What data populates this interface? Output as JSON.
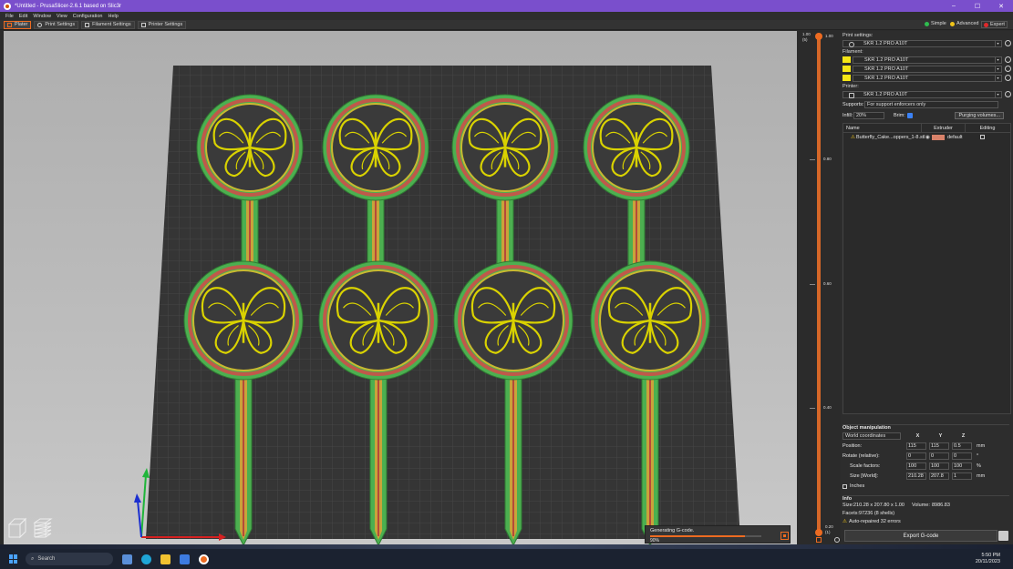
{
  "window": {
    "title": "*Untitled - PrusaSlicer-2.6.1 based on Slic3r",
    "controls": [
      "–",
      "☐",
      "✕"
    ]
  },
  "menu": [
    "File",
    "Edit",
    "Window",
    "View",
    "Configuration",
    "Help"
  ],
  "tabs": [
    {
      "label": "Plater",
      "icon": "plater-icon",
      "active": true
    },
    {
      "label": "Print Settings",
      "icon": "gear-icon",
      "active": false
    },
    {
      "label": "Filament Settings",
      "icon": "spool-icon",
      "active": false
    },
    {
      "label": "Printer Settings",
      "icon": "printer-icon",
      "active": false
    }
  ],
  "modes": [
    {
      "label": "Simple",
      "color": "#2fbd4f"
    },
    {
      "label": "Advanced",
      "color": "#f0c419"
    },
    {
      "label": "Expert",
      "color": "#e0292b"
    }
  ],
  "layer_slider": {
    "top_value": "1.00",
    "top_index": "(5)",
    "bottom_value": "0.20",
    "bottom_index": "(1)",
    "ticks": [
      "0.80",
      "0.60",
      "0.40"
    ],
    "accent": "#ed6b21"
  },
  "sidebar": {
    "print_settings_label": "Print settings:",
    "print_preset": "SKR 1.2 PRO A10T",
    "filament_label": "Filament:",
    "filaments": [
      {
        "name": "SKR 1.2 PRO A10T",
        "color": "#f5e616"
      },
      {
        "name": "SKR 1.2 PRO A10T",
        "color": "#f5e616"
      },
      {
        "name": "SKR 1.2 PRO A10T",
        "color": "#f5e616"
      }
    ],
    "printer_label": "Printer:",
    "printer_preset": "SKR 1.2 PRO A10T",
    "supports_label": "Supports:",
    "supports_value": "For support enforcers only",
    "infill_label": "Infill:",
    "infill_value": "20%",
    "brim_label": "Brim:",
    "purging_label": "Purging volumes...",
    "table_headers": [
      "Name",
      "Extruder",
      "Editing"
    ],
    "object_name": "Butterfly_Cake...oppers_1-8.stl",
    "extruder": "default",
    "extruder_color": "#d9826a"
  },
  "object_manipulation": {
    "title": "Object manipulation",
    "coords": "World coordinates",
    "axes": [
      "X",
      "Y",
      "Z"
    ],
    "position_label": "Position:",
    "position": [
      "115",
      "115",
      "0.5"
    ],
    "position_unit": "mm",
    "rotate_label": "Rotate (relative):",
    "rotate": [
      "0",
      "0",
      "0"
    ],
    "rotate_unit": "°",
    "scale_label": "Scale factors:",
    "scale": [
      "100",
      "100",
      "100"
    ],
    "scale_unit": "%",
    "size_label": "Size [World]:",
    "size": [
      "210.28",
      "207.8",
      "1"
    ],
    "size_unit": "mm",
    "inches_label": "Inches"
  },
  "info": {
    "title": "Info",
    "size_label": "Size:",
    "size_value": "210.28 x 207.80 x 1.00",
    "volume_label": "Volume:",
    "volume_value": "8986.83",
    "facets_label": "Facets:",
    "facets_value": "97236 (8 shells)",
    "repair_text": "Auto-repaired 32 errors"
  },
  "export_label": "Export G-code",
  "notification": {
    "text": "Generating G-code.",
    "percent": "90%",
    "progress": 0.85
  },
  "taskbar": {
    "search_placeholder": "Search",
    "time": "5:50 PM",
    "date": "20/11/2023",
    "weather_temp": "",
    "icons": [
      "widgets-icon",
      "edge-icon",
      "file-explorer-icon",
      "store-icon",
      "prusaslicer-icon"
    ]
  }
}
